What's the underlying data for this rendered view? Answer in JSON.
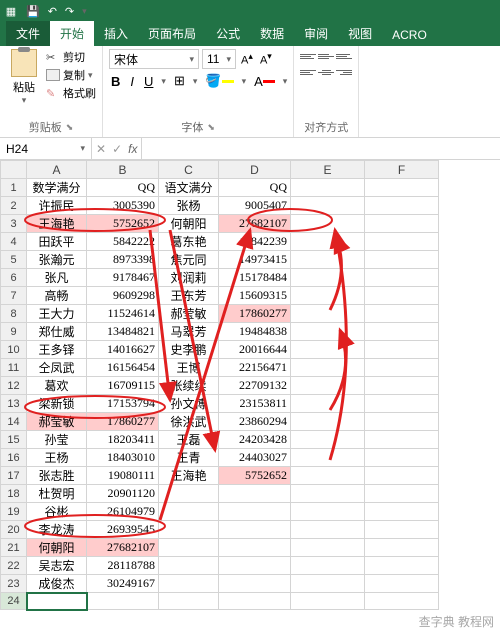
{
  "qat": {
    "save": "💾",
    "undo": "↶",
    "redo": "↷"
  },
  "tabs": {
    "file": "文件",
    "items": [
      "开始",
      "插入",
      "页面布局",
      "公式",
      "数据",
      "审阅",
      "视图",
      "ACRO"
    ],
    "active_index": 0
  },
  "ribbon": {
    "clipboard": {
      "paste": "粘贴",
      "cut": "剪切",
      "copy": "复制",
      "brush": "格式刷",
      "label": "剪贴板"
    },
    "font": {
      "name": "宋体",
      "size": "11",
      "label": "字体",
      "bold": "B",
      "italic": "I",
      "underline": "U"
    },
    "align": {
      "label": "对齐方式"
    }
  },
  "namebox": "H24",
  "fx_label": "fx",
  "columns": [
    "A",
    "B",
    "C",
    "D",
    "E",
    "F"
  ],
  "headers": {
    "A": "数学满分",
    "B": "QQ",
    "C": "语文满分",
    "D": "QQ"
  },
  "rows": [
    {
      "n": 1,
      "A": "数学满分",
      "B": "QQ",
      "C": "语文满分",
      "D": "QQ",
      "hdr": true
    },
    {
      "n": 2,
      "A": "许振民",
      "B": "3005390",
      "C": "张杨",
      "D": "9005407"
    },
    {
      "n": 3,
      "A": "王海艳",
      "B": "5752652",
      "C": "何朝阳",
      "D": "27682107",
      "hlA": true,
      "hlB": true,
      "hlD": true
    },
    {
      "n": 4,
      "A": "田跃平",
      "B": "5842222",
      "C": "葛东艳",
      "D": "11842239"
    },
    {
      "n": 5,
      "A": "张瀚元",
      "B": "8973398",
      "C": "焦元同",
      "D": "14973415"
    },
    {
      "n": 6,
      "A": "张凡",
      "B": "9178467",
      "C": "刘润莉",
      "D": "15178484"
    },
    {
      "n": 7,
      "A": "高畅",
      "B": "9609298",
      "C": "王东芳",
      "D": "15609315"
    },
    {
      "n": 8,
      "A": "王大力",
      "B": "11524614",
      "C": "郝莹敏",
      "D": "17860277",
      "hlD": true
    },
    {
      "n": 9,
      "A": "郑仕威",
      "B": "13484821",
      "C": "马翠芳",
      "D": "19484838"
    },
    {
      "n": 10,
      "A": "王多铎",
      "B": "14016627",
      "C": "史李鹏",
      "D": "20016644"
    },
    {
      "n": 11,
      "A": "仝凤武",
      "B": "16156454",
      "C": "王博",
      "D": "22156471"
    },
    {
      "n": 12,
      "A": "葛欢",
      "B": "16709115",
      "C": "张续续",
      "D": "22709132"
    },
    {
      "n": 13,
      "A": "梁新锁",
      "B": "17153794",
      "C": "孙文博",
      "D": "23153811"
    },
    {
      "n": 14,
      "A": "郝莹敏",
      "B": "17860277",
      "C": "徐洪武",
      "D": "23860294",
      "hlA": true,
      "hlB": true
    },
    {
      "n": 15,
      "A": "孙莹",
      "B": "18203411",
      "C": "王磊",
      "D": "24203428"
    },
    {
      "n": 16,
      "A": "王杨",
      "B": "18403010",
      "C": "王青",
      "D": "24403027"
    },
    {
      "n": 17,
      "A": "张志胜",
      "B": "19080111",
      "C": "王海艳",
      "D": "5752652",
      "hlD": true
    },
    {
      "n": 18,
      "A": "杜贺明",
      "B": "20901120"
    },
    {
      "n": 19,
      "A": "谷彬",
      "B": "26104979"
    },
    {
      "n": 20,
      "A": "李龙涛",
      "B": "26939545"
    },
    {
      "n": 21,
      "A": "何朝阳",
      "B": "27682107",
      "hlA": true,
      "hlB": true
    },
    {
      "n": 22,
      "A": "吴志宏",
      "B": "28118788"
    },
    {
      "n": 23,
      "A": "成俊杰",
      "B": "30249167"
    },
    {
      "n": 24,
      "sel": true
    }
  ],
  "watermark": "查字典 教程网"
}
